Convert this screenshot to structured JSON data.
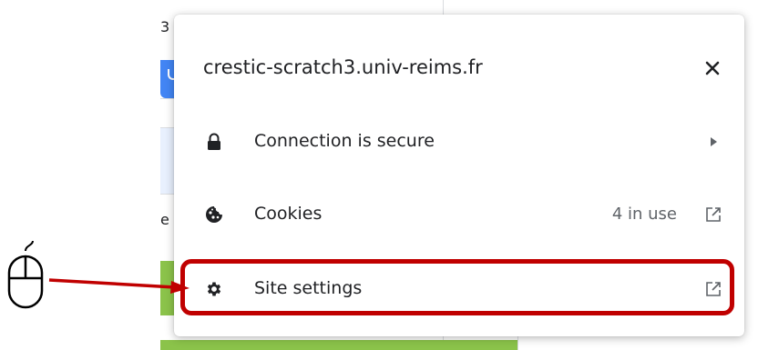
{
  "background": {
    "partial_text_top": "3",
    "partial_text_mid": "e"
  },
  "popup": {
    "site_title": "crestic-scratch3.univ-reims.fr",
    "close_icon": "close-icon",
    "rows": [
      {
        "label": "Connection is secure",
        "icon": "lock-icon",
        "status": "",
        "trail_icon": "chevron-right-icon"
      },
      {
        "label": "Cookies",
        "icon": "cookie-icon",
        "status": "4 in use",
        "trail_icon": "external-link-icon"
      },
      {
        "label": "Site settings",
        "icon": "gear-icon",
        "status": "",
        "trail_icon": "external-link-icon"
      }
    ]
  },
  "annotation": {
    "highlight_color": "#c00000",
    "arrow_color": "#c00000",
    "pointer_icon": "computer-mouse-icon"
  }
}
